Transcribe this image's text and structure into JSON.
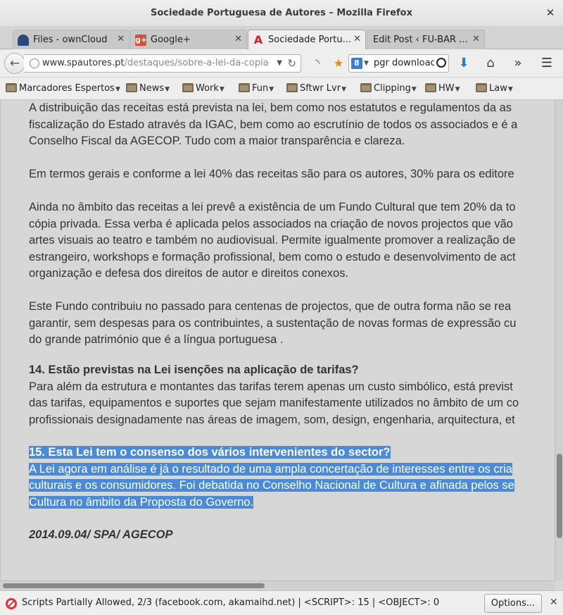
{
  "window": {
    "title": "Sociedade Portuguesa de Autores – Mozilla Firefox",
    "close": "✕"
  },
  "tabs": [
    {
      "label": "Files - ownCloud",
      "icon": "owncloud-cloud-icon",
      "close": "✕"
    },
    {
      "label": "Google+",
      "icon": "google-plus-icon",
      "favicon_text": "g+",
      "close": "✕"
    },
    {
      "label": "Sociedade Portu...",
      "icon": "spa-logo-icon",
      "favicon_text": "A",
      "close": "✕"
    },
    {
      "label": "Edit Post ‹ FU-BAR ...",
      "icon": "none",
      "close": "✕"
    }
  ],
  "toolbar": {
    "new_tab": "+",
    "url_domain": "www.spautores.pt",
    "url_path": "/destaques/sobre-a-lei-da-copia-priva",
    "search_engine_letter": "8",
    "search_value": "pgr downloads",
    "chevron_more": "»"
  },
  "bookmarks": [
    {
      "label": "Marcadores Espertos"
    },
    {
      "label": "News"
    },
    {
      "label": "Work"
    },
    {
      "label": "Fun"
    },
    {
      "label": "Sftwr Lvr"
    },
    {
      "label": "Clipping"
    },
    {
      "label": "HW"
    },
    {
      "label": "Law"
    }
  ],
  "article": {
    "p1": [
      "A distribuição das receitas está prevista na lei, bem como nos estatutos e regulamentos da as",
      "fiscalização do Estado através da IGAC, bem como ao escrutínio de todos os associados e é a",
      "Conselho Fiscal da AGECOP. Tudo com a maior transparência e clareza."
    ],
    "p2": [
      "Em termos gerais e conforme a lei 40% das receitas são para os autores, 30% para os editore"
    ],
    "p3": [
      "Ainda no âmbito das receitas a lei prevê a existência de um Fundo Cultural que tem 20% da to",
      "cópia privada. Essa verba é aplicada pelos associados na criação de novos projectos que vão",
      "artes visuais ao teatro e também no audiovisual. Permite igualmente promover a realização de",
      "estrangeiro, workshops e formação profissional, bem como o estudo e desenvolvimento de act",
      "organização e defesa dos direitos de autor e direitos conexos."
    ],
    "p4": [
      "Este Fundo contribuiu no passado para centenas de projectos, que de outra forma não se rea",
      "garantir, sem despesas para os contribuintes, a sustentação de novas formas de expressão cu",
      "do grande património que é a língua portuguesa ."
    ],
    "h14": "14. Estão previstas na Lei isenções na aplicação de tarifas?",
    "p5": [
      "Para além da estrutura e montantes das tarifas terem apenas um custo simbólico, está previst",
      "das tarifas, equipamentos e suportes que sejam manifestamente utilizados no âmbito de um co",
      "profissionais designadamente nas áreas de imagem, som, design, engenharia, arquitectura, et"
    ],
    "h15": "15. Esta Lei tem o consenso dos vários intervenientes do sector?",
    "p6": [
      "A Lei agora em análise é já o resultado de uma ampla concertação de interesses entre os cria",
      "culturais e os consumidores. Foi debatida no Conselho Nacional de Cultura e afinada pelos se",
      "Cultura no âmbito da Proposta do Governo."
    ],
    "signature": "2014.09.04/ SPA/ AGECOP"
  },
  "status": {
    "message": "Scripts Partially Allowed, 2/3 (facebook.com, akamaihd.net) | <SCRIPT>: 15 | <OBJECT>: 0",
    "options_label": "Options...",
    "close": "✕"
  },
  "colors": {
    "selection": "#4a8ad6",
    "google_plus": "#dd4b39",
    "spa_red": "#d81f26"
  }
}
